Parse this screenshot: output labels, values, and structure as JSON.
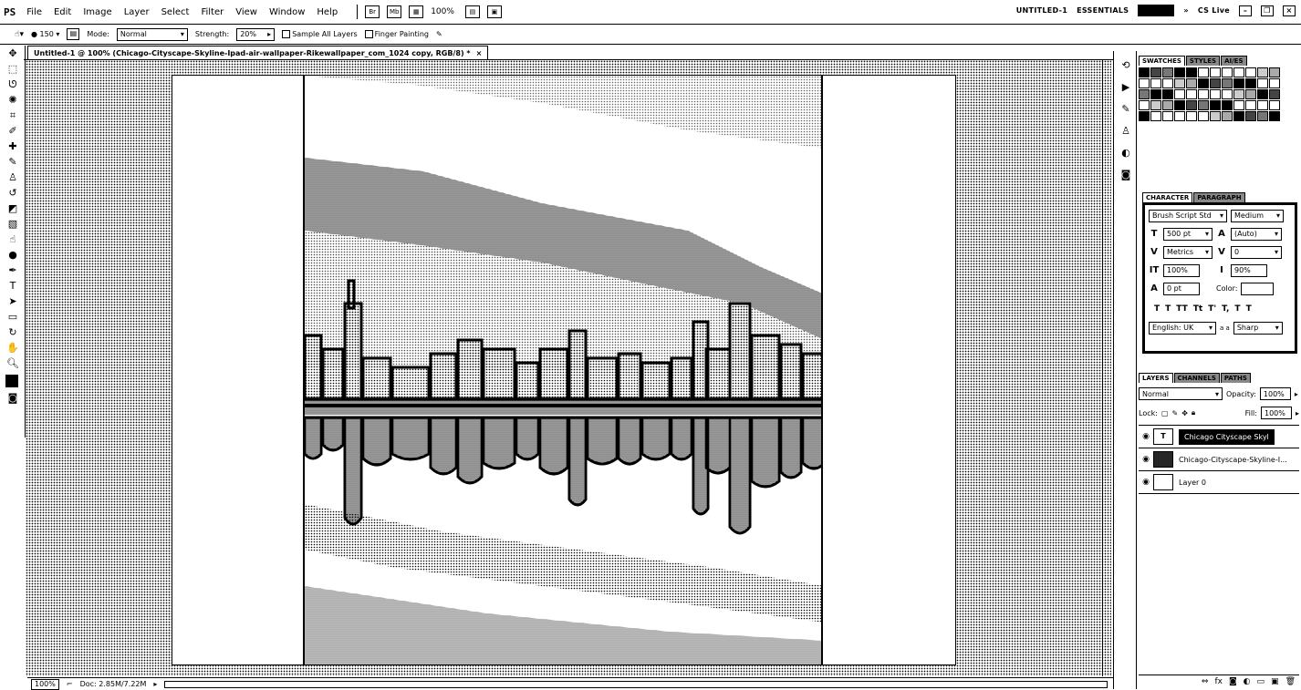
{
  "app": {
    "logo": "PS",
    "menus": [
      "File",
      "Edit",
      "Image",
      "Layer",
      "Select",
      "Filter",
      "View",
      "Window",
      "Help"
    ],
    "zoom": "100%",
    "doc_name": "UNTITLED-1",
    "workspace": "ESSENTIALS",
    "cs_live": "CS Live"
  },
  "options": {
    "brush_size": "150",
    "mode_label": "Mode:",
    "mode_value": "Normal",
    "strength_label": "Strength:",
    "strength_value": "20%",
    "sample_all_layers": "Sample All Layers",
    "finger_painting": "Finger Painting"
  },
  "document": {
    "tab_title": "Untitled-1 @ 100% (Chicago-Cityscape-Skyline-Ipad-air-wallpaper-Rikewallpaper_com_1024 copy, RGB/8) *"
  },
  "status": {
    "zoom": "100%",
    "doc_size": "Doc: 2.85M/7.22M"
  },
  "panels": {
    "swatches_tab": "SWATCHES",
    "styles_tab": "STYLES",
    "third_tab": "AI/ES",
    "character_tab": "CHARACTER",
    "paragraph_tab": "PARAGRAPH",
    "font_family": "Brush Script Std",
    "font_style": "Medium",
    "font_size": "500 pt",
    "leading": "(Auto)",
    "kerning": "Metrics",
    "tracking": "0",
    "vertical_scale": "100%",
    "horizontal_scale": "90%",
    "baseline_shift": "0 pt",
    "color_label": "Color:",
    "style_buttons": [
      "T",
      "T",
      "TT",
      "Tt",
      "T'",
      "T,",
      "T",
      "T"
    ],
    "language": "English: UK",
    "aa_label": "a a",
    "antialias": "Sharp",
    "layers_tab": "LAYERS",
    "channels_tab": "CHANNELS",
    "paths_tab": "PATHS",
    "blend_mode": "Normal",
    "opacity_label": "Opacity:",
    "opacity_value": "100%",
    "lock_label": "Lock:",
    "fill_label": "Fill:",
    "fill_value": "100%",
    "layers": [
      {
        "name": "Chicago Cityscape Skyl",
        "type": "text",
        "selected": true
      },
      {
        "name": "Chicago-Cityscape-Skyline-I...",
        "type": "image",
        "selected": false
      },
      {
        "name": "Layer 0",
        "type": "image",
        "selected": false
      }
    ]
  },
  "colors": {
    "foreground": "#000000",
    "background": "#ffffff",
    "accent": "#000000"
  }
}
